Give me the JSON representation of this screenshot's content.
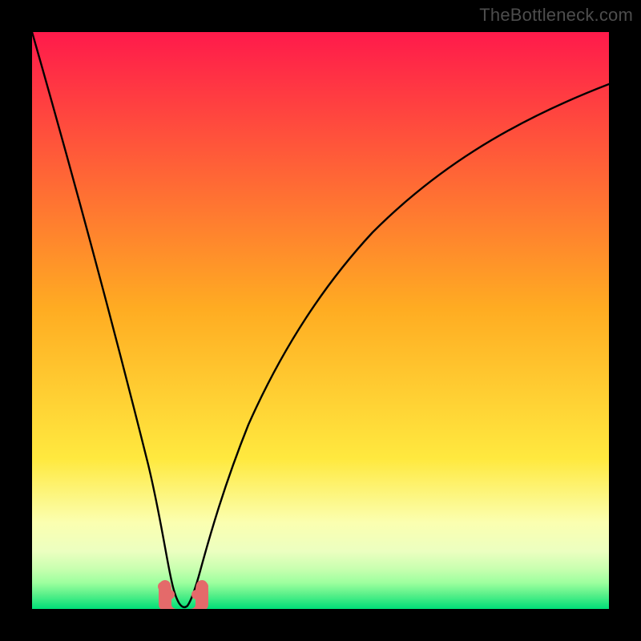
{
  "watermark": "TheBottleneck.com",
  "chart_data": {
    "type": "line",
    "title": "",
    "xlabel": "",
    "ylabel": "",
    "xlim": [
      0,
      100
    ],
    "ylim": [
      0,
      100
    ],
    "grid": false,
    "legend": false,
    "background": {
      "type": "vertical-gradient",
      "stops": [
        {
          "pos": 0.0,
          "color": "#ff1a4b"
        },
        {
          "pos": 0.5,
          "color": "#ffb321"
        },
        {
          "pos": 0.78,
          "color": "#ffef4a"
        },
        {
          "pos": 0.88,
          "color": "#f6ffa6"
        },
        {
          "pos": 0.93,
          "color": "#d8ffb0"
        },
        {
          "pos": 0.965,
          "color": "#8dff9a"
        },
        {
          "pos": 1.0,
          "color": "#00e27a"
        }
      ]
    },
    "series": [
      {
        "name": "bottleneck-curve",
        "description": "V-shaped curve; y=100 means worst (top), y=0 means best (bottom green). Minimum around x≈25.",
        "x": [
          0,
          5,
          10,
          15,
          18,
          20,
          22,
          23,
          24,
          25,
          26,
          27,
          28,
          30,
          33,
          37,
          42,
          50,
          60,
          70,
          80,
          90,
          100
        ],
        "y": [
          100,
          82,
          62,
          40,
          26,
          16,
          8,
          4,
          1,
          0,
          1,
          4,
          9,
          18,
          30,
          42,
          52,
          63,
          72,
          79,
          84,
          88,
          91
        ]
      }
    ],
    "highlight": {
      "description": "Pink rounded tick marks near the trough of the curve",
      "points_x": [
        22.2,
        23.1,
        26.9,
        27.8
      ],
      "y_approx": 3,
      "color": "#e86a6a"
    }
  }
}
